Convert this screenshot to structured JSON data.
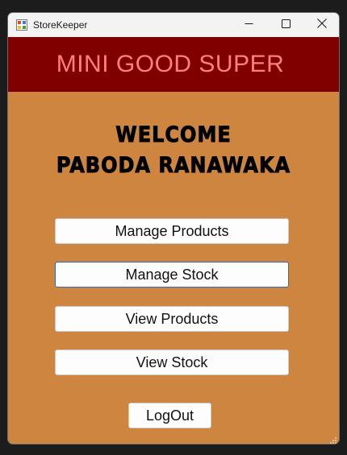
{
  "window": {
    "title": "StoreKeeper"
  },
  "titlebar": {
    "app_icon": "app-icon",
    "minimize_icon": "minimize-icon",
    "maximize_icon": "maximize-icon",
    "close_icon": "close-icon"
  },
  "banner": {
    "title": "MINI GOOD SUPER",
    "background": "#800000",
    "color": "#ff7f7f"
  },
  "welcome": {
    "line1": "WELCOME",
    "line2": "PABODA RANAWAKA"
  },
  "menu": {
    "manage_products": "Manage Products",
    "manage_stock": "Manage Stock",
    "view_products": "View Products",
    "view_stock": "View Stock"
  },
  "logout": {
    "label": "LogOut"
  },
  "colors": {
    "form_background": "#cd853f",
    "button_background": "#fdfdfd",
    "focus_border": "#2f6db5"
  }
}
